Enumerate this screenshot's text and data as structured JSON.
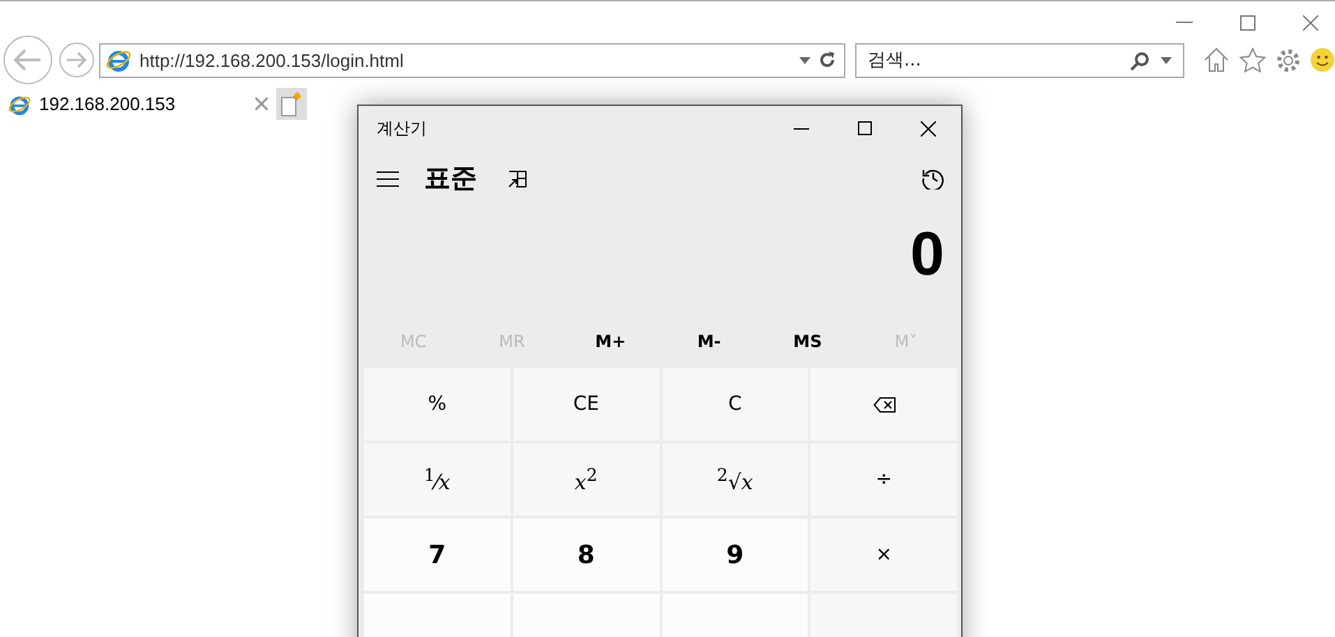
{
  "browser": {
    "address": "http://192.168.200.153/login.html",
    "search": {
      "placeholder": "검색..."
    },
    "tabs": [
      {
        "label": "192.168.200.153",
        "selected": true
      }
    ]
  },
  "calculator": {
    "title": "계산기",
    "mode": "표준",
    "display": "0",
    "memory": [
      {
        "label": "MC",
        "disabled": true
      },
      {
        "label": "MR",
        "disabled": true
      },
      {
        "label": "M+",
        "disabled": false
      },
      {
        "label": "M-",
        "disabled": false
      },
      {
        "label": "MS",
        "disabled": false
      },
      {
        "label": "M˅",
        "disabled": true
      }
    ],
    "keys": [
      {
        "kind": "op",
        "label": "%"
      },
      {
        "kind": "op",
        "label": "CE"
      },
      {
        "kind": "op",
        "label": "C"
      },
      {
        "kind": "backspace"
      },
      {
        "kind": "math",
        "label": "$^{1}$⁄*x*"
      },
      {
        "kind": "math",
        "label": "*x*$^{2}$"
      },
      {
        "kind": "math",
        "label": "$^{2}$√*x*"
      },
      {
        "kind": "op",
        "label": "÷"
      },
      {
        "kind": "digit",
        "label": "7"
      },
      {
        "kind": "digit",
        "label": "8"
      },
      {
        "kind": "digit",
        "label": "9"
      },
      {
        "kind": "op",
        "label": "×"
      },
      {
        "kind": "digit_blank"
      },
      {
        "kind": "digit_blank"
      },
      {
        "kind": "digit_blank"
      },
      {
        "kind": "op_blank"
      }
    ]
  }
}
